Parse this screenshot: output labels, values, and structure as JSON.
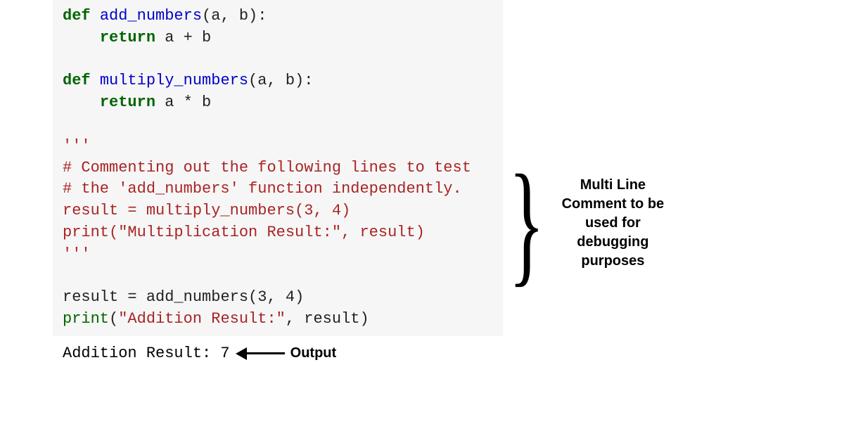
{
  "code": {
    "def": "def",
    "ret": "return",
    "fn_add": "add_numbers",
    "fn_mul": "multiply_numbers",
    "params": "(a, b):",
    "ret_add": " a + b",
    "ret_mul": " a * b",
    "triple": "'''",
    "comment1": "# Commenting out the following lines to test",
    "comment2": "# the 'add_numbers' function independently.",
    "assign_mul": "result = multiply_numbers(3, 4)",
    "print_mul_a": "print(",
    "print_mul_str": "\"Multiplication Result:\"",
    "print_mul_b": ", result)",
    "assign_add_a": "result = ",
    "assign_add_call": "add_numbers(3, 4)",
    "print_add_a": "print(",
    "print_add_str": "\"Addition Result:\"",
    "print_add_b": ", result)",
    "print_kw": "print"
  },
  "output": {
    "text": "Addition Result: 7",
    "label": "Output"
  },
  "annotation": {
    "line1": "Multi Line",
    "line2": "Comment to be",
    "line3": "used for",
    "line4": "debugging",
    "line5": "purposes"
  }
}
